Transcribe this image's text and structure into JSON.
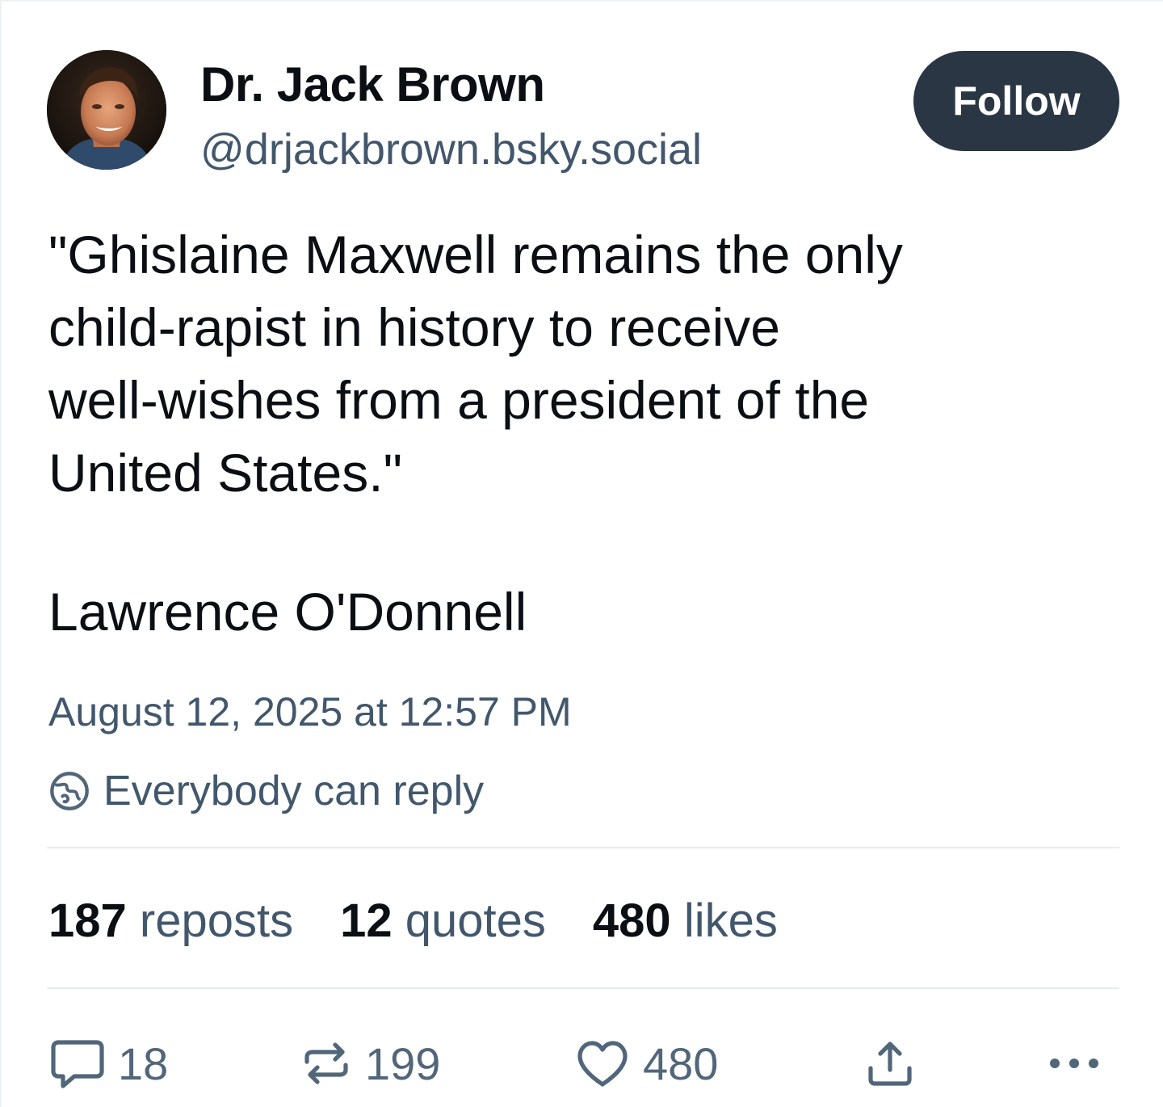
{
  "post": {
    "author": {
      "name": "Dr. Jack Brown",
      "handle": "@drjackbrown.bsky.social",
      "avatar": "avatar-photo"
    },
    "follow_label": "Follow",
    "text": "\"Ghislaine Maxwell remains the only\nchild-rapist in history to receive\nwell-wishes from a president of the\nUnited States.\"",
    "attribution": "Lawrence O'Donnell",
    "timestamp": "August 12, 2025 at 12:57 PM",
    "reply_setting": "Everybody can reply",
    "stats": [
      {
        "count": "187",
        "label": "reposts"
      },
      {
        "count": "12",
        "label": "quotes"
      },
      {
        "count": "480",
        "label": "likes"
      }
    ],
    "actions": {
      "reply_count": "18",
      "repost_count": "199",
      "like_count": "480"
    }
  },
  "icons": {
    "reply": "comment-bubble-icon",
    "repost": "repost-arrows-icon",
    "like": "heart-icon",
    "share": "share-upload-icon",
    "more": "more-dots-icon",
    "reply_setting": "globe-icon"
  },
  "colors": {
    "follow_bg": "#2a3643",
    "secondary_text": "#42576c",
    "primary_text": "#0b0f14",
    "divider": "#e6ebef"
  }
}
